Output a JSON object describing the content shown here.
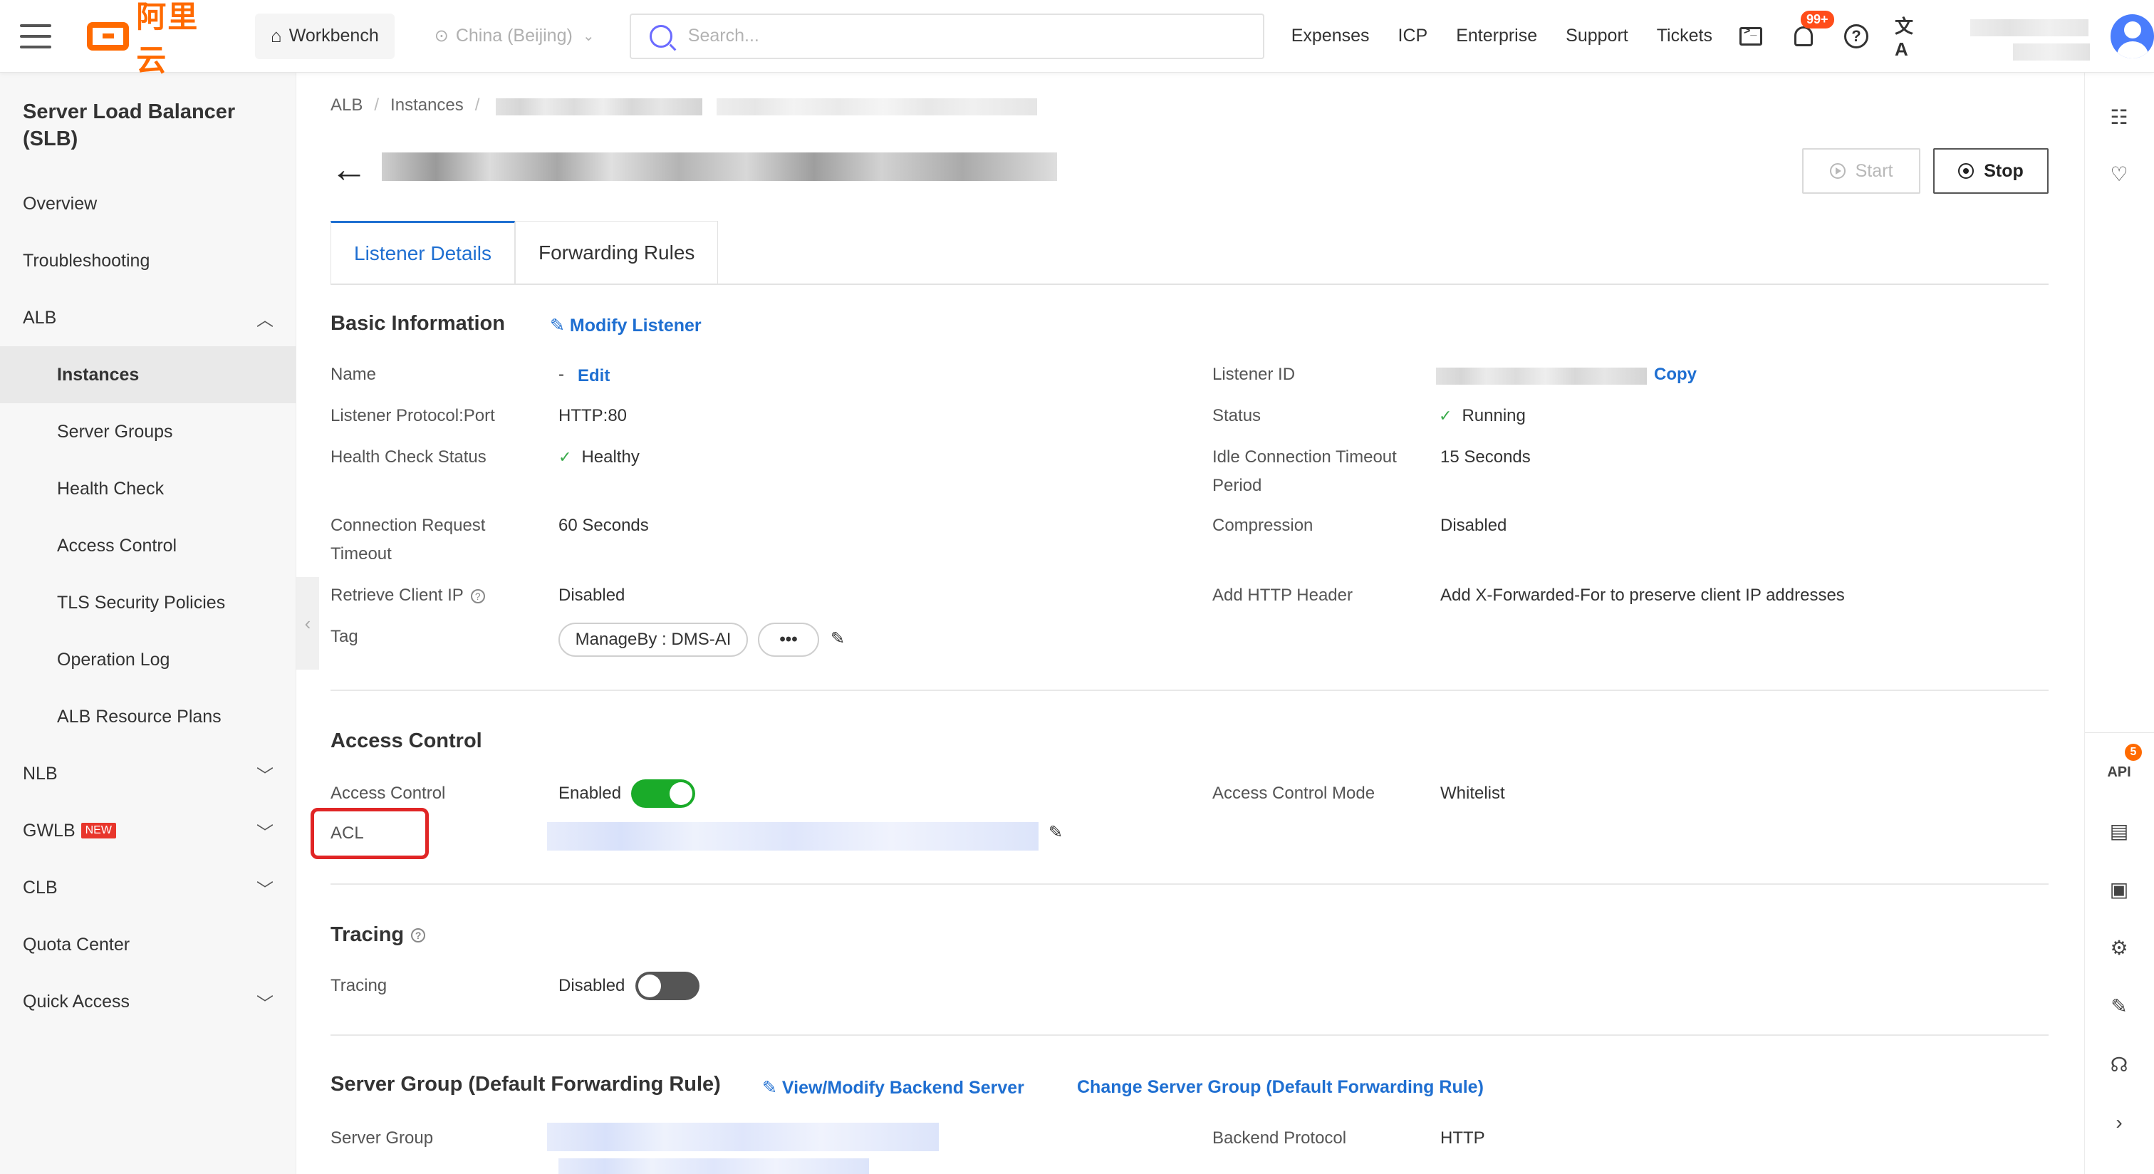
{
  "topbar": {
    "logo_text": "阿里云",
    "workbench": "Workbench",
    "region": "China (Beijing)",
    "search_placeholder": "Search...",
    "nav": [
      "Expenses",
      "ICP",
      "Enterprise",
      "Support",
      "Tickets"
    ],
    "notification_count": "99+"
  },
  "sidebar": {
    "title": "Server Load Balancer (SLB)",
    "items": [
      {
        "label": "Overview"
      },
      {
        "label": "Troubleshooting"
      },
      {
        "label": "ALB"
      },
      {
        "label": "Instances"
      },
      {
        "label": "Server Groups"
      },
      {
        "label": "Health Check"
      },
      {
        "label": "Access Control"
      },
      {
        "label": "TLS Security Policies"
      },
      {
        "label": "Operation Log"
      },
      {
        "label": "ALB Resource Plans"
      },
      {
        "label": "NLB"
      },
      {
        "label": "GWLB",
        "badge": "NEW"
      },
      {
        "label": "CLB"
      },
      {
        "label": "Quota Center"
      },
      {
        "label": "Quick Access"
      }
    ]
  },
  "rail": {
    "api_badge": "5",
    "api_label": "API"
  },
  "main": {
    "breadcrumb": [
      "ALB",
      "Instances"
    ],
    "buttons": {
      "start": "Start",
      "stop": "Stop"
    },
    "tabs": [
      "Listener Details",
      "Forwarding Rules"
    ],
    "basic": {
      "title": "Basic Information",
      "modify_link": "Modify Listener",
      "name_label": "Name",
      "name_value": "-",
      "name_edit": "Edit",
      "protocol_label": "Listener Protocol:Port",
      "protocol_value": "HTTP:80",
      "health_label": "Health Check Status",
      "health_value": "Healthy",
      "conn_timeout_label_1": "Connection Request",
      "conn_timeout_label_2": "Timeout",
      "conn_timeout_value": "60 Seconds",
      "client_ip_label": "Retrieve Client IP",
      "client_ip_value": "Disabled",
      "tag_label": "Tag",
      "tag_value": "ManageBy : DMS-AI",
      "tag_more": "•••",
      "listener_id_label": "Listener ID",
      "copy": "Copy",
      "status_label": "Status",
      "status_value": "Running",
      "idle_label_1": "Idle Connection Timeout",
      "idle_label_2": "Period",
      "idle_value": "15 Seconds",
      "compression_label": "Compression",
      "compression_value": "Disabled",
      "header_label": "Add HTTP Header",
      "header_value": "Add X-Forwarded-For to preserve client IP addresses"
    },
    "access": {
      "title": "Access Control",
      "ac_label": "Access Control",
      "ac_value": "Enabled",
      "ac_enabled": true,
      "acl_label": "ACL",
      "mode_label": "Access Control Mode",
      "mode_value": "Whitelist"
    },
    "tracing": {
      "title": "Tracing",
      "label": "Tracing",
      "value": "Disabled",
      "enabled": false
    },
    "server_group": {
      "title": "Server Group (Default Forwarding Rule)",
      "view_link": "View/Modify Backend Server",
      "change_link": "Change Server Group (Default Forwarding Rule)",
      "sg_label": "Server Group",
      "backend_label": "Backend Protocol",
      "backend_value": "HTTP"
    }
  }
}
